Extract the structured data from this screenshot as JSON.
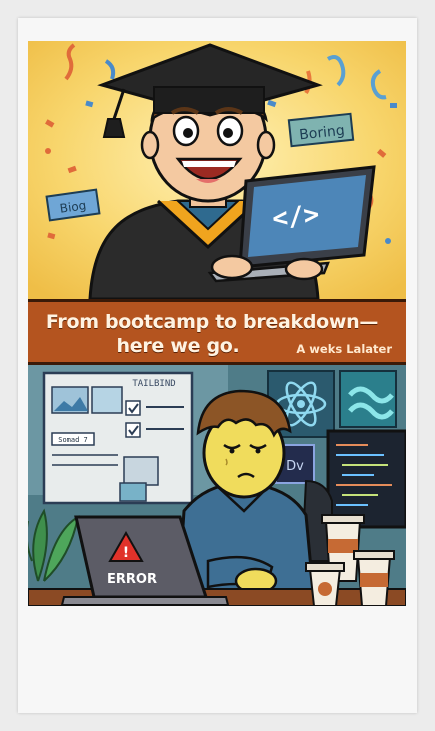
{
  "caption": {
    "line1": "From bootcamp to breakdown—",
    "line2": "here we go.",
    "subtitle": "A weks Lalater"
  },
  "panel_top": {
    "sticker_boring": "Boring",
    "sticker_blog": "Biog",
    "screen_code": "</>"
  },
  "panel_bottom": {
    "whiteboard_label": "TAILBIND",
    "note_label": "Somad 7",
    "dv_label": "Dv",
    "laptop_error": "ERROR"
  },
  "colors": {
    "caption_bg": "#b4541f",
    "top_bg": "#f6d66e",
    "gown": "#2b2b2b",
    "laptop": "#4d86b8",
    "bottom_bg": "#4f7c88"
  }
}
